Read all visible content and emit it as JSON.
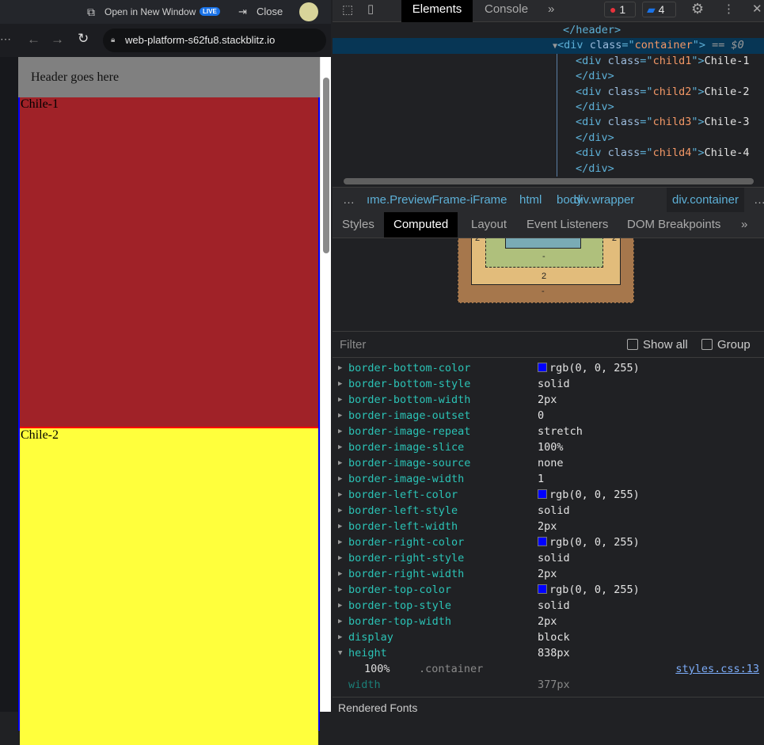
{
  "topbar": {
    "open_new_window": "Open in New Window",
    "live_badge": "LIVE",
    "close": "Close"
  },
  "browser": {
    "url": "web-platform-s62fu8.stackblitz.io",
    "menu": "⋯"
  },
  "preview": {
    "header": "Header goes here",
    "child1": "Chile-1",
    "child2": "Chile-2",
    "colors": {
      "header": "#808080",
      "child1": "#a02228",
      "child2": "#ffff3c",
      "container_border": "#0000ff",
      "child1_border": "#ff0000"
    }
  },
  "devtools": {
    "tabs": [
      "Elements",
      "Console"
    ],
    "more": "»",
    "errors": "1",
    "messages": "4",
    "dom": {
      "header_close": "</header>",
      "container_open_tag": "div",
      "container_class": "container",
      "selected_suffix": " == $0",
      "children": [
        {
          "cls": "child1",
          "text": "Chile-1"
        },
        {
          "cls": "child2",
          "text": "Chile-2"
        },
        {
          "cls": "child3",
          "text": "Chile-3"
        },
        {
          "cls": "child4",
          "text": "Chile-4"
        }
      ],
      "close_div": "</div>"
    },
    "breadcrumbs": [
      "…",
      "ıme.PreviewFrame-iFrame",
      "html",
      "body",
      "div.wrapper",
      "div.container",
      "…"
    ],
    "subtabs": [
      "Styles",
      "Computed",
      "Layout",
      "Event Listeners",
      "DOM Breakpoints",
      "»"
    ],
    "boxmodel": {
      "padding_bottom": "-",
      "border_bottom": "2",
      "margin_bottom": "-",
      "border_left": "2",
      "border_right": "2"
    },
    "filter": {
      "placeholder": "Filter",
      "show_all": "Show all",
      "group": "Group"
    },
    "properties": [
      {
        "name": "border-bottom-color",
        "value": "rgb(0, 0, 255)",
        "swatch": "#0000ff"
      },
      {
        "name": "border-bottom-style",
        "value": "solid"
      },
      {
        "name": "border-bottom-width",
        "value": "2px"
      },
      {
        "name": "border-image-outset",
        "value": "0"
      },
      {
        "name": "border-image-repeat",
        "value": "stretch"
      },
      {
        "name": "border-image-slice",
        "value": "100%"
      },
      {
        "name": "border-image-source",
        "value": "none"
      },
      {
        "name": "border-image-width",
        "value": "1"
      },
      {
        "name": "border-left-color",
        "value": "rgb(0, 0, 255)",
        "swatch": "#0000ff"
      },
      {
        "name": "border-left-style",
        "value": "solid"
      },
      {
        "name": "border-left-width",
        "value": "2px"
      },
      {
        "name": "border-right-color",
        "value": "rgb(0, 0, 255)",
        "swatch": "#0000ff"
      },
      {
        "name": "border-right-style",
        "value": "solid"
      },
      {
        "name": "border-right-width",
        "value": "2px"
      },
      {
        "name": "border-top-color",
        "value": "rgb(0, 0, 255)",
        "swatch": "#0000ff"
      },
      {
        "name": "border-top-style",
        "value": "solid"
      },
      {
        "name": "border-top-width",
        "value": "2px"
      },
      {
        "name": "display",
        "value": "block"
      },
      {
        "name": "height",
        "value": "838px",
        "expanded": true
      }
    ],
    "height_detail": {
      "value": "100%",
      "selector": ".container",
      "source": "styles.css:13"
    },
    "width": {
      "name": "width",
      "value": "377px"
    },
    "rendered_fonts": "Rendered Fonts"
  }
}
